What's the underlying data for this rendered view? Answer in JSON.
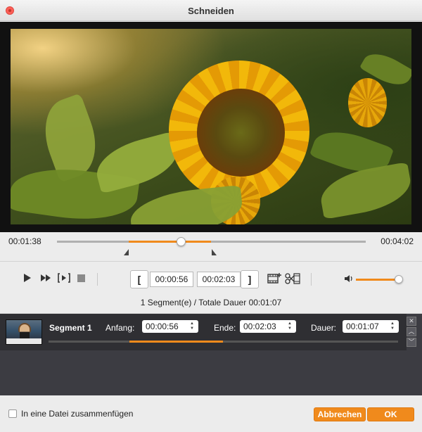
{
  "window": {
    "title": "Schneiden"
  },
  "timeline": {
    "current_time": "00:01:38",
    "total_time": "00:04:02",
    "selection_start_fraction": 0.232,
    "selection_end_fraction": 0.5,
    "playhead_fraction": 0.402
  },
  "controls": {
    "start_bracket": "[",
    "start_time": "00:00:56",
    "end_time": "00:02:03",
    "end_bracket": "]",
    "volume_fraction": 0.92
  },
  "summary": "1 Segment(e) / Totale Dauer 00:01:07",
  "segment": {
    "name": "Segment 1",
    "start_label": "Anfang:",
    "start_value": "00:00:56",
    "end_label": "Ende:",
    "end_value": "00:02:03",
    "duration_label": "Dauer:",
    "duration_value": "00:01:07",
    "range_start_fraction": 0.232,
    "range_end_fraction": 0.5
  },
  "footer": {
    "merge_label": "In eine Datei zusammenfügen",
    "merge_checked": false,
    "cancel_label": "Abbrechen",
    "ok_label": "OK"
  },
  "colors": {
    "accent": "#f08a1c",
    "close": "#fc5f57",
    "segment_bg": "#2f2f33"
  }
}
